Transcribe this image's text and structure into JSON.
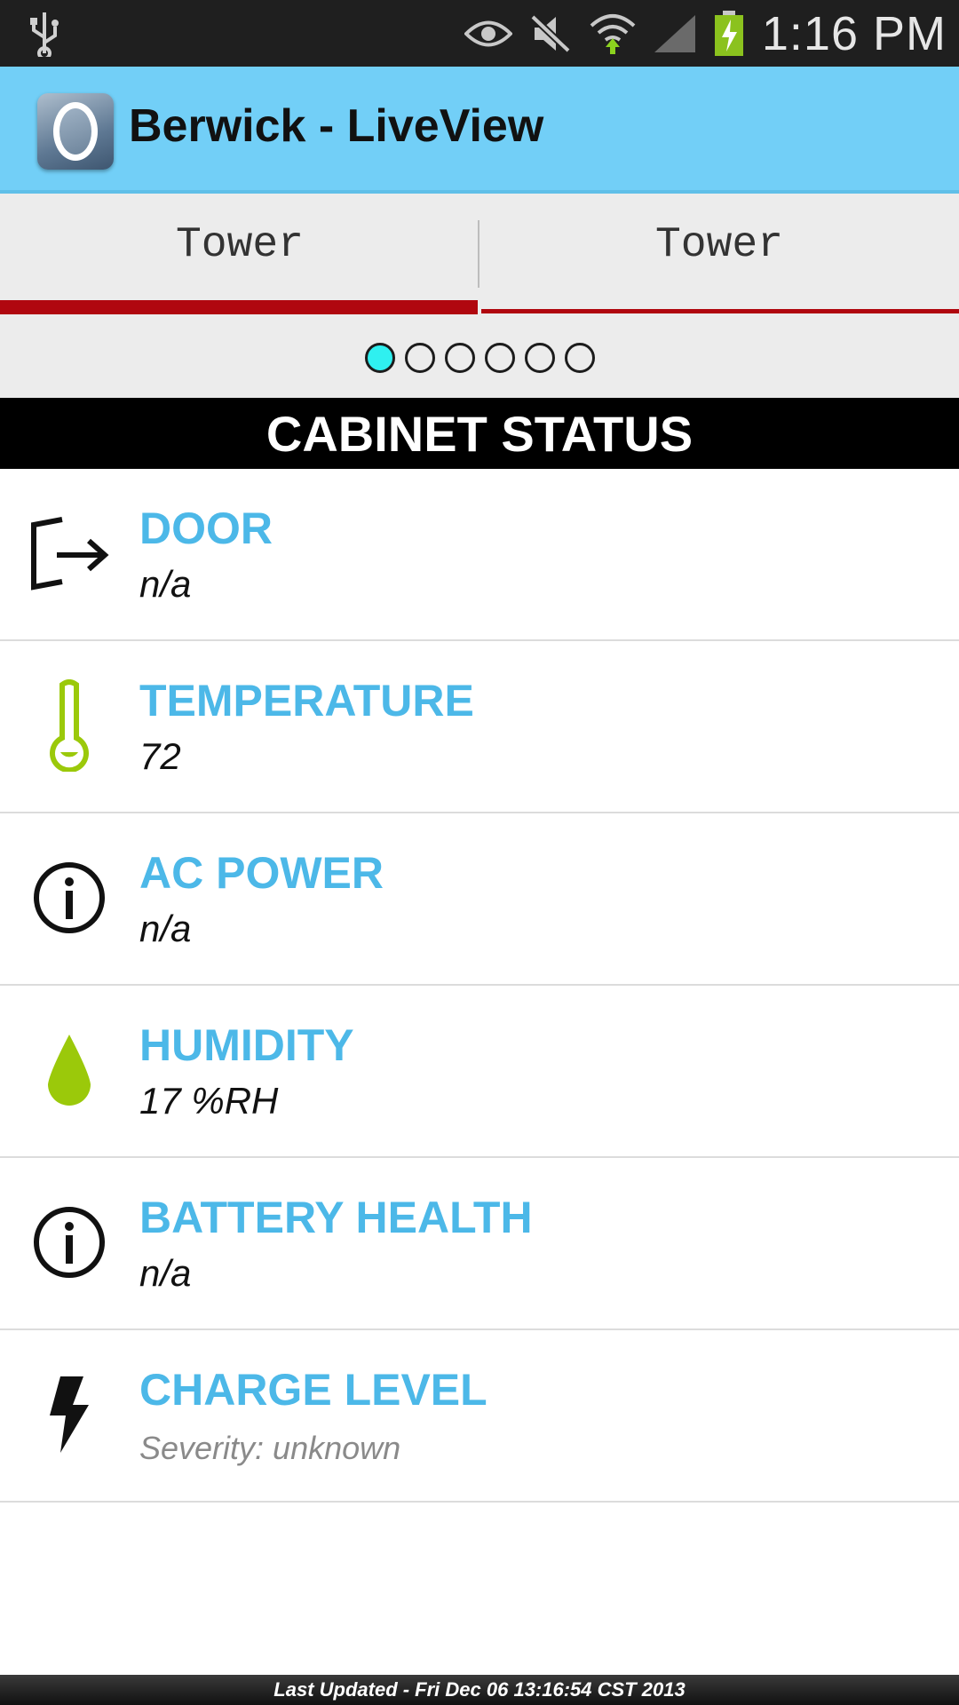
{
  "status_bar": {
    "time": "1:16 PM",
    "icons": [
      "usb-icon",
      "eye-icon",
      "mute-icon",
      "wifi-icon",
      "signal-icon",
      "battery-charging-icon"
    ]
  },
  "action_bar": {
    "title": "Berwick - LiveView",
    "logo_icon": "app-logo-icon"
  },
  "tabs": [
    {
      "label": "Tower",
      "active": true
    },
    {
      "label": "Tower",
      "active": false
    }
  ],
  "pager": {
    "count": 6,
    "active_index": 0
  },
  "section": {
    "title": "CABINET STATUS"
  },
  "items": [
    {
      "icon": "door-exit-icon",
      "title": "DOOR",
      "value": "n/a"
    },
    {
      "icon": "thermometer-icon",
      "title": "TEMPERATURE",
      "value": "72"
    },
    {
      "icon": "info-icon",
      "title": "AC POWER",
      "value": "n/a"
    },
    {
      "icon": "water-drop-icon",
      "title": "HUMIDITY",
      "value": "17 %RH"
    },
    {
      "icon": "info-icon",
      "title": "BATTERY HEALTH",
      "value": "n/a"
    },
    {
      "icon": "lightning-icon",
      "title": "CHARGE LEVEL",
      "value": "Severity: unknown"
    }
  ],
  "footer": {
    "text": "Last Updated - Fri Dec 06 13:16:54 CST 2013"
  },
  "colors": {
    "action_bar": "#72cff7",
    "tab_indicator": "#b0070f",
    "item_title": "#4cb8e8",
    "active_dot": "#2ff0f0",
    "icon_green": "#9bc90a"
  }
}
